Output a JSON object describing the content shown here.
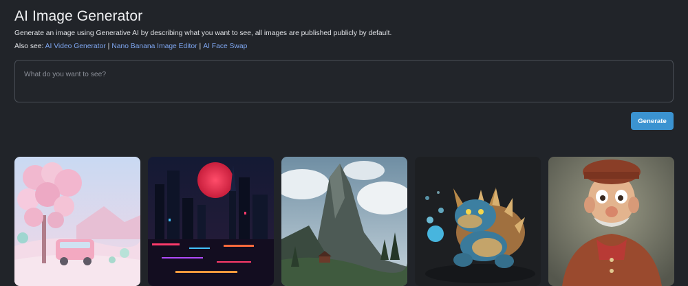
{
  "header": {
    "title": "AI Image Generator",
    "description": "Generate an image using Generative AI by describing what you want to see, all images are published publicly by default.",
    "also_see_label": "Also see:",
    "links": [
      {
        "label": "AI Video Generator"
      },
      {
        "label": "Nano Banana Image Editor"
      },
      {
        "label": "AI Face Swap"
      }
    ],
    "separator": "|"
  },
  "prompt": {
    "placeholder": "What do you want to see?",
    "value": ""
  },
  "actions": {
    "generate_label": "Generate"
  },
  "gallery": {
    "images": [
      {
        "name": "pastel-trees-van-image"
      },
      {
        "name": "neon-city-red-moon-image"
      },
      {
        "name": "mountain-peak-cabin-image"
      },
      {
        "name": "turtle-monster-image"
      },
      {
        "name": "old-man-character-image"
      }
    ]
  },
  "colors": {
    "background": "#212429",
    "link": "#7ea6f0",
    "button": "#3b93d1"
  }
}
